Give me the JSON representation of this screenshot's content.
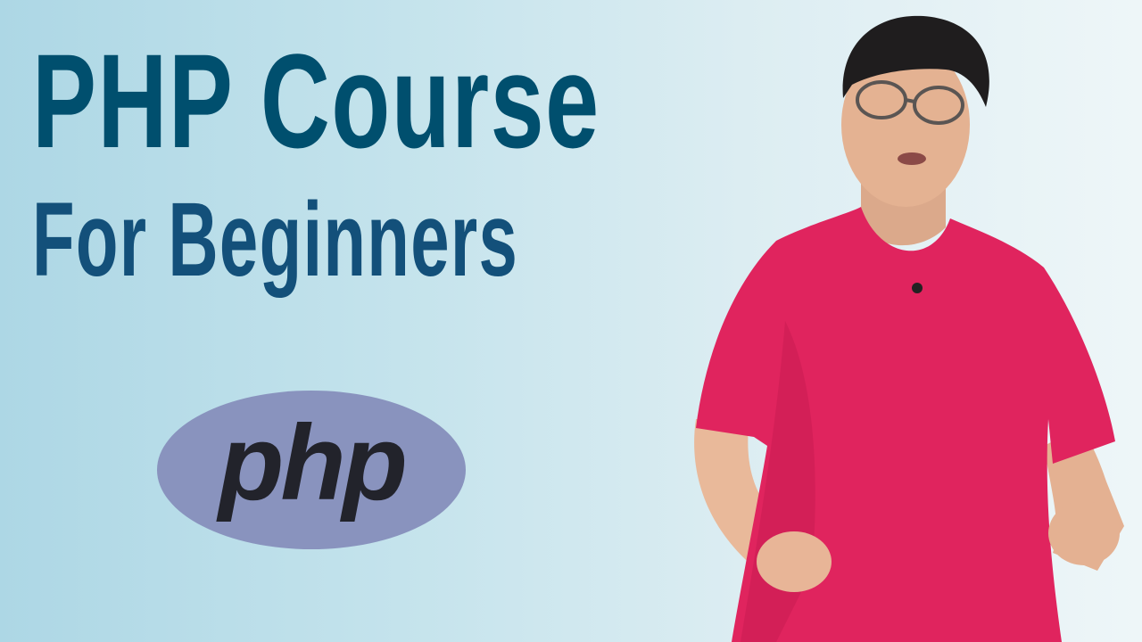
{
  "title": {
    "line1": "PHP Course",
    "line2": "For Beginners"
  },
  "logo": {
    "text": "php",
    "oval_color": "#8993be",
    "text_color": "#22232b"
  },
  "colors": {
    "title_line1": "#004f6e",
    "title_line2": "#13507a",
    "background_left": "#add7e5",
    "background_right": "#eef6f8",
    "shirt": "#e0245e"
  }
}
